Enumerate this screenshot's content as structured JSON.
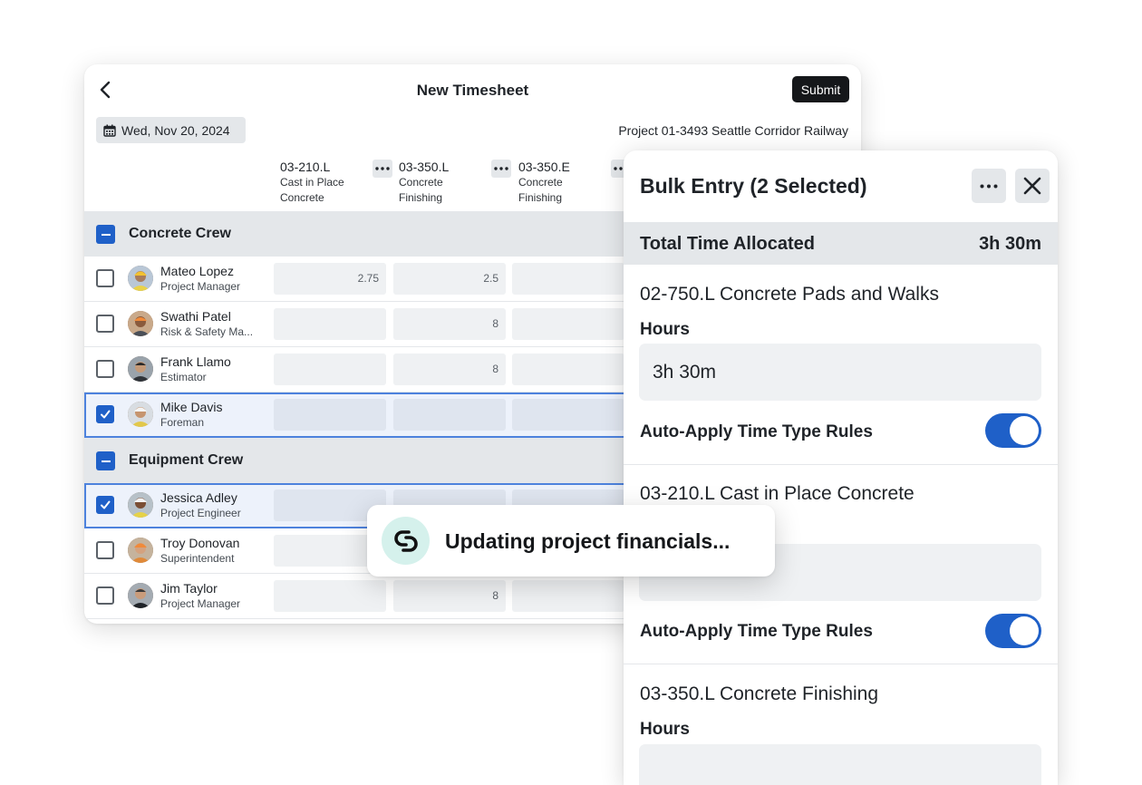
{
  "timesheet": {
    "title": "New Timesheet",
    "submit_label": "Submit",
    "date": "Wed, Nov 20, 2024",
    "project": "Project 01-3493 Seattle Corridor Railway",
    "columns": [
      {
        "code": "03-210.L",
        "desc": "Cast in Place Concrete"
      },
      {
        "code": "03-350.L",
        "desc": "Concrete Finishing"
      },
      {
        "code": "03-350.E",
        "desc": "Concrete Finishing"
      }
    ],
    "groups": [
      {
        "label": "Concrete Crew",
        "rows": [
          {
            "name": "Mateo Lopez",
            "role": "Project Manager",
            "checked": false,
            "values": [
              "2.75",
              "2.5",
              ""
            ]
          },
          {
            "name": "Swathi Patel",
            "role": "Risk & Safety Ma...",
            "checked": false,
            "values": [
              "",
              "8",
              ""
            ]
          },
          {
            "name": "Frank Llamo",
            "role": "Estimator",
            "checked": false,
            "values": [
              "",
              "8",
              ""
            ]
          },
          {
            "name": "Mike Davis",
            "role": "Foreman",
            "checked": true,
            "values": [
              "",
              "",
              ""
            ]
          }
        ]
      },
      {
        "label": "Equipment Crew",
        "rows": [
          {
            "name": "Jessica Adley",
            "role": "Project Engineer",
            "checked": true,
            "values": [
              "",
              "",
              ""
            ]
          },
          {
            "name": "Troy Donovan",
            "role": "Superintendent",
            "checked": false,
            "values": [
              "",
              "",
              ""
            ]
          },
          {
            "name": "Jim Taylor",
            "role": "Project Manager",
            "checked": false,
            "values": [
              "",
              "8",
              ""
            ]
          }
        ]
      }
    ]
  },
  "bulk_entry": {
    "title": "Bulk Entry (2 Selected)",
    "total_label": "Total Time Allocated",
    "total_value": "3h 30m",
    "sections": [
      {
        "title": "02-750.L Concrete Pads and Walks",
        "hours_label": "Hours",
        "hours_value": "3h 30m",
        "rule_label": "Auto-Apply Time Type Rules",
        "rule_on": true
      },
      {
        "title": "03-210.L Cast in Place Concrete",
        "hours_label": "Hours",
        "hours_value": "",
        "rule_label": "Auto-Apply Time Type Rules",
        "rule_on": true
      },
      {
        "title": "03-350.L Concrete Finishing",
        "hours_label": "Hours",
        "hours_value": ""
      }
    ]
  },
  "toast": {
    "message": "Updating project financials..."
  },
  "colors": {
    "accent": "#1f60c8",
    "dark_button": "#15171a",
    "group_bg": "#e4e7ea",
    "toast_icon_bg": "#d5f1ec"
  },
  "icons": [
    "back-arrow-icon",
    "calendar-icon",
    "more-icon",
    "close-icon",
    "checkmark-icon",
    "app-logo-icon"
  ]
}
